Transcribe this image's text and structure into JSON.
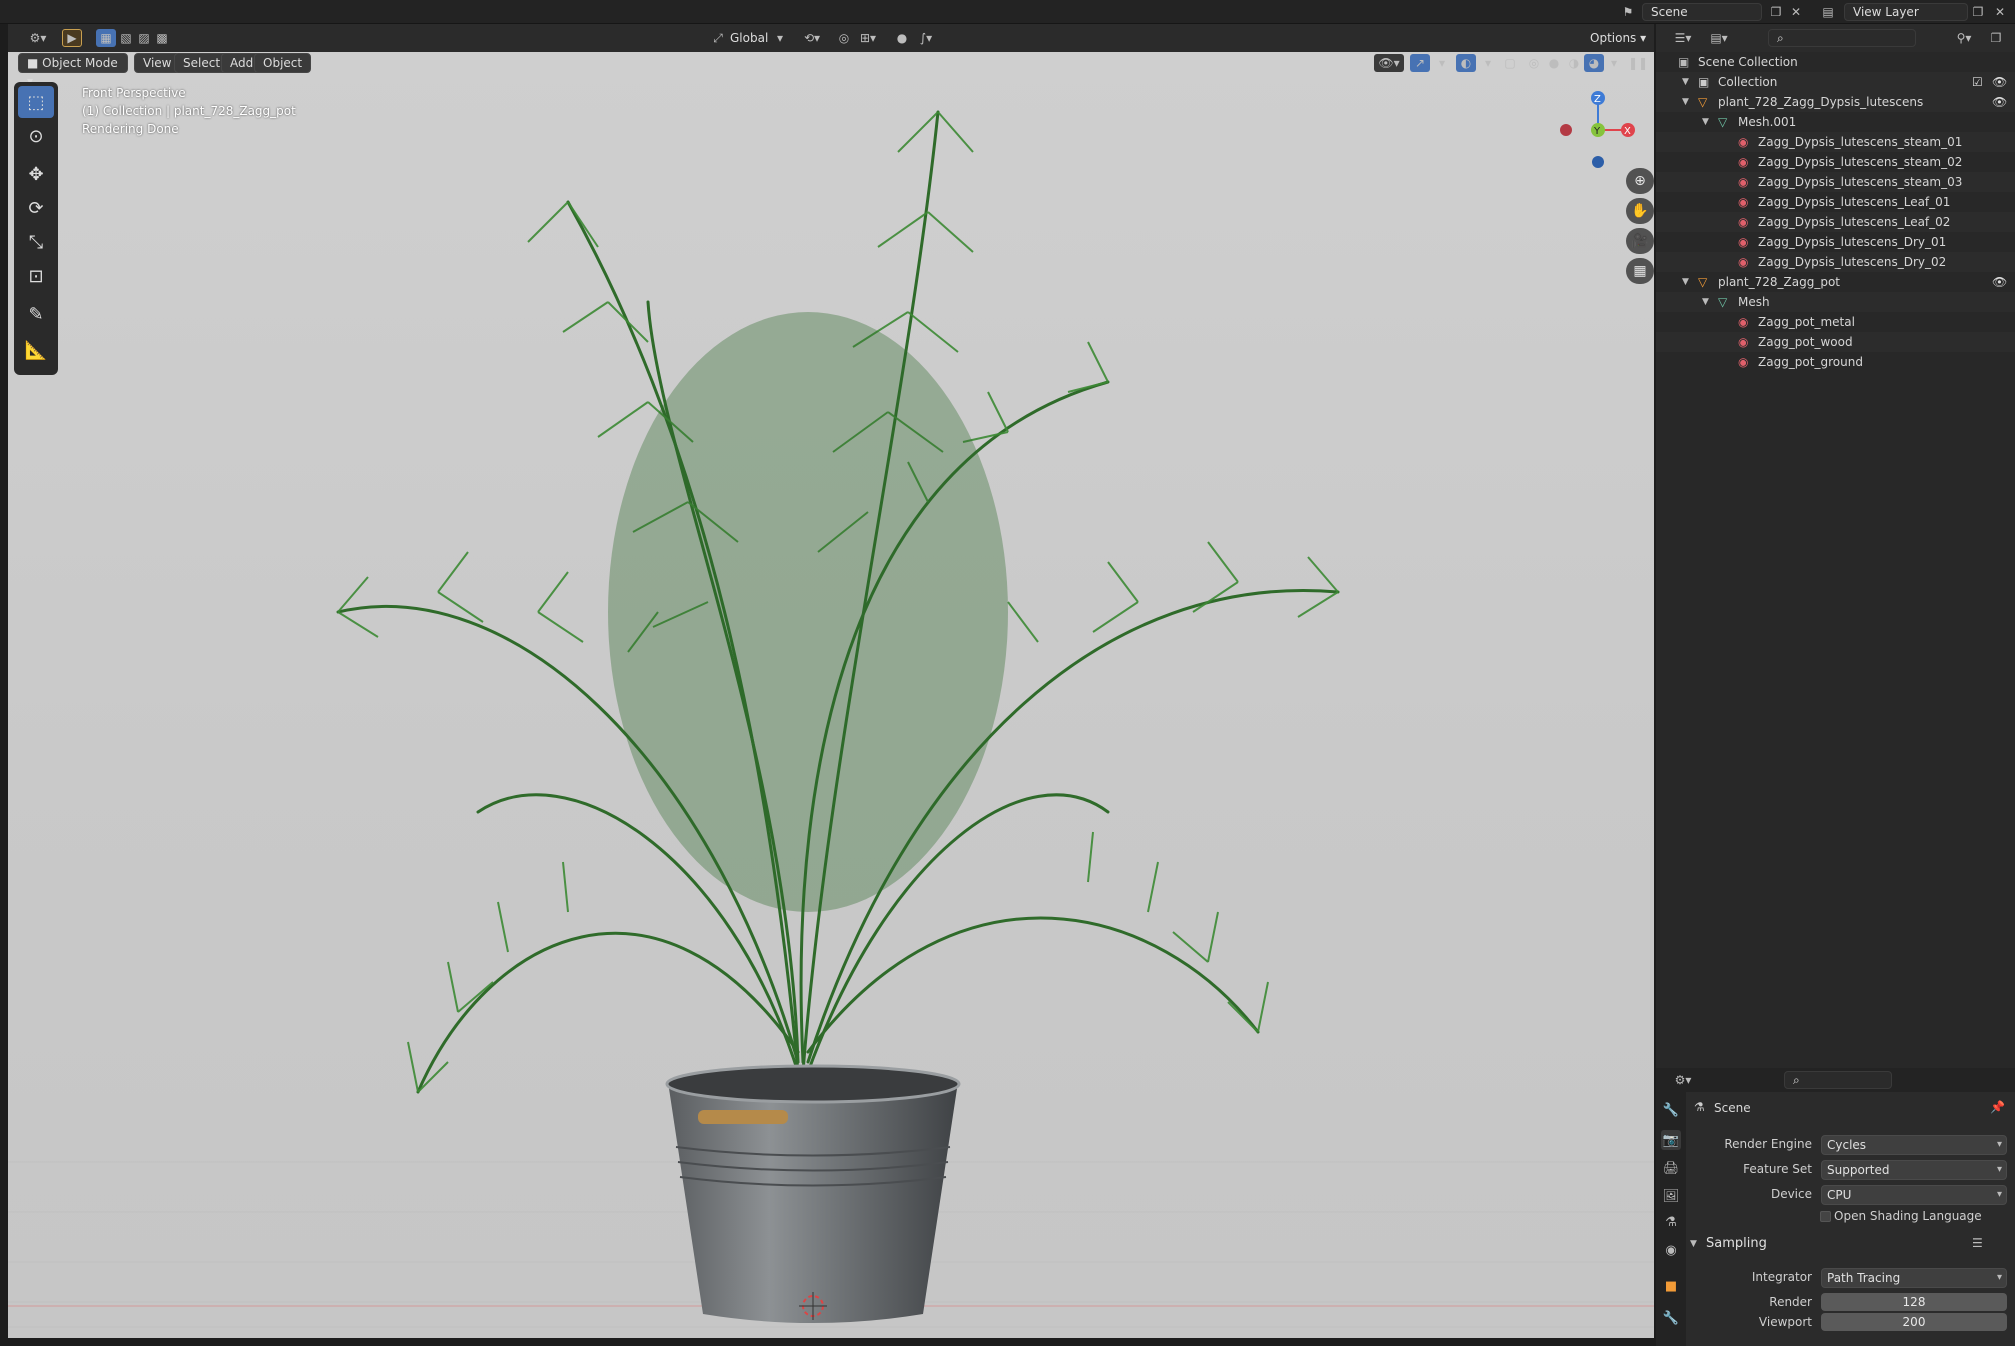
{
  "topbar": {
    "scene_label": "Scene",
    "view_layer_label": "View Layer"
  },
  "viewport_header": {
    "transform_orientation": "Global",
    "options_label": "Options"
  },
  "viewport_menu": {
    "mode": "Object Mode",
    "view": "View",
    "select": "Select",
    "add": "Add",
    "object": "Object"
  },
  "viewport_overlay": {
    "line1": "Front Perspective",
    "line2": "(1) Collection | plant_728_Zagg_pot",
    "line3": "Rendering Done"
  },
  "gizmo": {
    "z": "Z",
    "y": "Y",
    "x": "X"
  },
  "outliner": {
    "search_placeholder": "",
    "root": "Scene Collection",
    "collection": "Collection",
    "items": [
      {
        "label": "plant_728_Zagg_Dypsis_lutescens",
        "type": "object",
        "depth": 2
      },
      {
        "label": "Mesh.001",
        "type": "mesh",
        "depth": 3
      },
      {
        "label": "Zagg_Dypsis_lutescens_steam_01",
        "type": "material",
        "depth": 4
      },
      {
        "label": "Zagg_Dypsis_lutescens_steam_02",
        "type": "material",
        "depth": 4
      },
      {
        "label": "Zagg_Dypsis_lutescens_steam_03",
        "type": "material",
        "depth": 4
      },
      {
        "label": "Zagg_Dypsis_lutescens_Leaf_01",
        "type": "material",
        "depth": 4
      },
      {
        "label": "Zagg_Dypsis_lutescens_Leaf_02",
        "type": "material",
        "depth": 4
      },
      {
        "label": "Zagg_Dypsis_lutescens_Dry_01",
        "type": "material",
        "depth": 4
      },
      {
        "label": "Zagg_Dypsis_lutescens_Dry_02",
        "type": "material",
        "depth": 4
      },
      {
        "label": "plant_728_Zagg_pot",
        "type": "object",
        "depth": 2
      },
      {
        "label": "Mesh",
        "type": "mesh",
        "depth": 3
      },
      {
        "label": "Zagg_pot_metal",
        "type": "material",
        "depth": 4
      },
      {
        "label": "Zagg_pot_wood",
        "type": "material",
        "depth": 4
      },
      {
        "label": "Zagg_pot_ground",
        "type": "material",
        "depth": 4
      }
    ]
  },
  "properties": {
    "context": "Scene",
    "render_engine": {
      "label": "Render Engine",
      "value": "Cycles"
    },
    "feature_set": {
      "label": "Feature Set",
      "value": "Supported"
    },
    "device": {
      "label": "Device",
      "value": "CPU"
    },
    "osl": {
      "label": "Open Shading Language",
      "checked": false
    },
    "sampling": {
      "label": "Sampling",
      "expanded": true
    },
    "integrator": {
      "label": "Integrator",
      "value": "Path Tracing"
    },
    "render_samples": {
      "label": "Render",
      "value": "128"
    },
    "viewport_samples": {
      "label": "Viewport",
      "value": "200"
    }
  },
  "colors": {
    "accent": "#4772b3",
    "x_axis": "#e0444c",
    "y_axis": "#86c33c",
    "z_axis": "#3e7bd6",
    "object_icon": "#f29b37",
    "mesh_icon": "#6fc3a6",
    "material_icon": "#e0606b"
  }
}
